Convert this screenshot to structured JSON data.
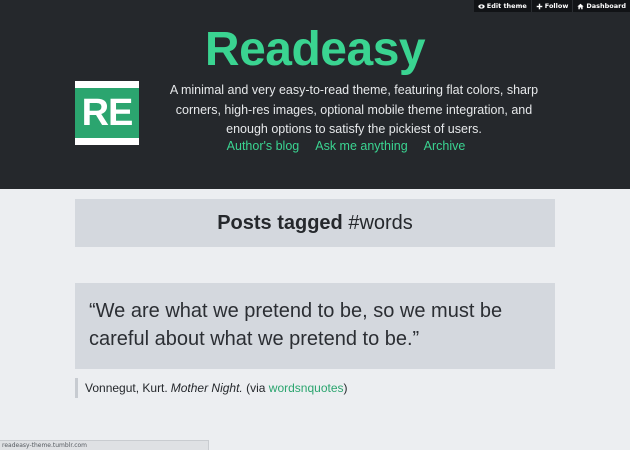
{
  "controls": {
    "edit_theme": "Edit theme",
    "follow": "Follow",
    "dashboard": "Dashboard"
  },
  "header": {
    "title": "Readeasy",
    "avatar_text": "RE",
    "description": "A minimal and very easy-to-read theme, featuring flat colors, sharp corners, high-res images, optional mobile theme integration, and enough options to satisfy the pickiest of users.",
    "nav": [
      "Author's blog",
      "Ask me anything",
      "Archive"
    ]
  },
  "tag_banner": {
    "prefix": "Posts tagged ",
    "tag": "#words"
  },
  "post": {
    "quote": "“We are what we pretend to be, so we must be careful about what we pretend to be.”",
    "source_author": "Vonnegut, Kurt.",
    "source_title": "Mother Night.",
    "via_prefix": "(via ",
    "via_link": "wordsnquotes",
    "via_suffix": ")"
  },
  "status_bar": {
    "url": "readeasy-theme.tumblr.com"
  },
  "colors": {
    "header_bg": "#25282c",
    "accent": "#3ad491",
    "link": "#2ba56f",
    "page_bg": "#eceef1",
    "panel_bg": "#d4d8de"
  }
}
